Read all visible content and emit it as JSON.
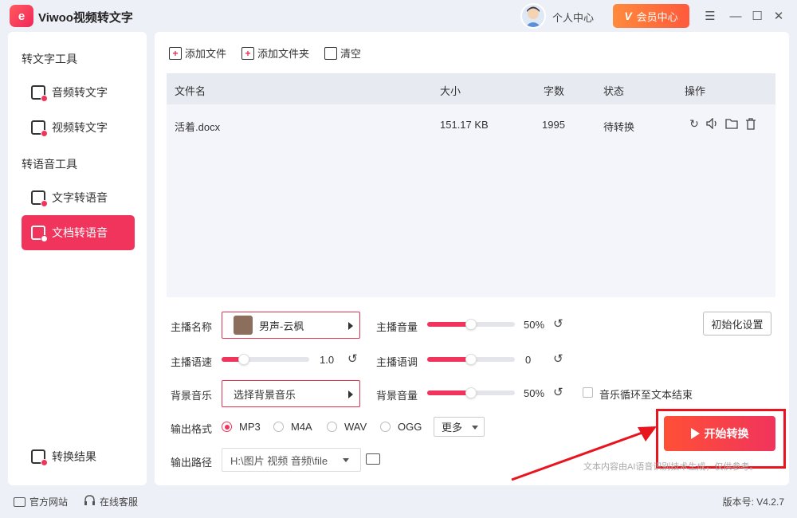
{
  "titlebar": {
    "logo_text": "e",
    "app_title": "Viwoo视频转文字",
    "user_center": "个人中心",
    "vip_icon": "V",
    "vip_label": "会员中心",
    "menu_glyph": "☰",
    "minimize_glyph": "—",
    "maximize_glyph": "☐",
    "close_glyph": "✕"
  },
  "sidebar": {
    "sections": [
      {
        "title": "转文字工具",
        "items": [
          {
            "label": "音频转文字",
            "active": false
          },
          {
            "label": "视频转文字",
            "active": false
          }
        ]
      },
      {
        "title": "转语音工具",
        "items": [
          {
            "label": "文字转语音",
            "active": false
          },
          {
            "label": "文档转语音",
            "active": true
          }
        ]
      }
    ],
    "bottom_item": "转换结果",
    "accent_color": "#f0345c"
  },
  "toolbar": {
    "add_file": "添加文件",
    "add_folder": "添加文件夹",
    "clear": "清空"
  },
  "table": {
    "headers": [
      "文件名",
      "大小",
      "字数",
      "状态",
      "操作"
    ],
    "rows": [
      {
        "name": "活着.docx",
        "size": "151.17 KB",
        "words": "1995",
        "status": "待转换",
        "actions": [
          "refresh-icon",
          "speaker-icon",
          "folder-icon",
          "trash-icon"
        ]
      }
    ]
  },
  "settings": {
    "voice_label": "主播名称",
    "voice_value": "男声-云枫",
    "volume_label": "主播音量",
    "volume_value": "50%",
    "volume_fraction": 0.5,
    "speed_label": "主播语速",
    "speed_value": "1.0",
    "speed_fraction": 0.25,
    "pitch_label": "主播语调",
    "pitch_value": "0",
    "pitch_fraction": 0.5,
    "bgm_label": "背景音乐",
    "bgm_value": "选择背景音乐",
    "bgm_volume_label": "背景音量",
    "bgm_volume_value": "50%",
    "bgm_volume_fraction": 0.5,
    "loop_label": "音乐循环至文本结束",
    "loop_checked": false,
    "init_button": "初始化设置",
    "format_label": "输出格式",
    "formats": [
      "MP3",
      "M4A",
      "WAV",
      "OGG"
    ],
    "selected_format": "MP3",
    "more_label": "更多",
    "path_label": "输出路径",
    "path_value": "H:\\图片 视频 音频\\file"
  },
  "action": {
    "start_label": "开始转换",
    "disclaimer": "文本内容由AI语音识别技术生成，仅供参考。"
  },
  "statusbar": {
    "website": "官方网站",
    "support": "在线客服",
    "version": "版本号: V4.2.7"
  }
}
